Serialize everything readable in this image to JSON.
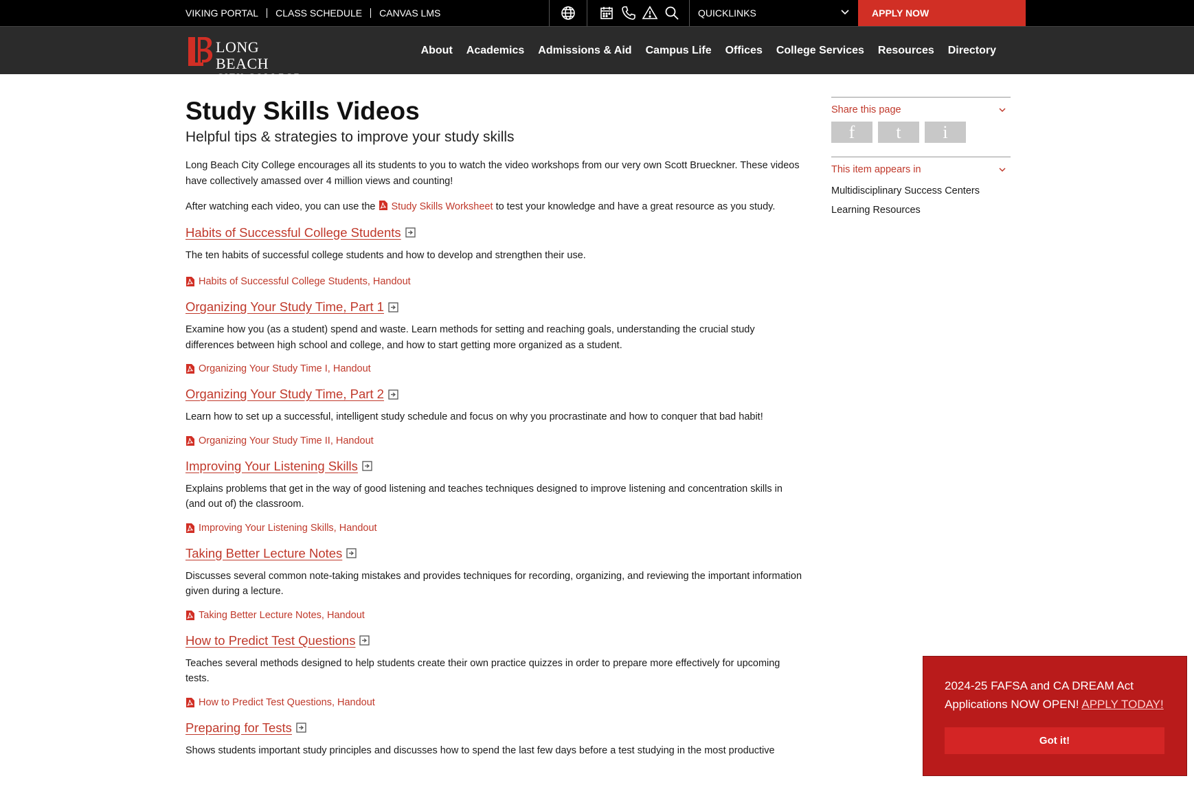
{
  "topbar": {
    "links": [
      "VIKING PORTAL",
      "CLASS SCHEDULE",
      "CANVAS LMS"
    ],
    "quicklinks_label": "QUICKLINKS",
    "apply_label": "APPLY NOW"
  },
  "logo": {
    "line1": "LONG BEACH",
    "line2": "CITY COLLEGE"
  },
  "nav": [
    "About",
    "Academics",
    "Admissions & Aid",
    "Campus Life",
    "Offices",
    "College Services",
    "Resources",
    "Directory"
  ],
  "page": {
    "title": "Study Skills Videos",
    "subtitle": "Helpful tips & strategies to improve your study skills",
    "intro": "Long Beach City College encourages all its students to you to watch the video workshops from our very own Scott Brueckner. These videos have collectively amassed over 4 million views and counting!",
    "worksheet_prefix": "After watching each video, you can use the",
    "worksheet_link": "Study Skills Worksheet",
    "worksheet_suffix": "to test your knowledge and have a great resource as you study."
  },
  "videos": [
    {
      "title": "Habits of Successful College Students",
      "desc": "The ten habits of successful college students and how to develop and strengthen their use.",
      "handout": "Habits of Successful College Students, Handout"
    },
    {
      "title": "Organizing Your Study Time, Part 1",
      "desc": "Examine how you (as a student) spend and waste. Learn methods for setting and reaching goals, understanding the crucial study differences between high school and college, and how to start getting more organized as a student.",
      "handout": "Organizing Your Study Time I, Handout"
    },
    {
      "title": "Organizing Your Study Time, Part 2",
      "desc": "Learn how to set up a successful, intelligent study schedule and focus on why you procrastinate and how to conquer that bad habit!",
      "handout": "Organizing Your Study Time II, Handout"
    },
    {
      "title": "Improving Your Listening Skills",
      "desc": "Explains problems that get in the way of good listening and teaches techniques designed to improve listening and concentration skills in (and out of) the classroom.",
      "handout": "Improving Your Listening Skills, Handout"
    },
    {
      "title": "Taking Better Lecture Notes",
      "desc": "Discusses several common note-taking mistakes and provides techniques for recording, organizing, and reviewing the important information given during a lecture.",
      "handout": "Taking Better Lecture Notes, Handout"
    },
    {
      "title": "How to Predict Test Questions",
      "desc": "Teaches several methods designed to help students create their own practice quizzes in order to prepare more effectively for upcoming tests.",
      "handout": "How to Predict Test Questions, Handout"
    },
    {
      "title": "Preparing for Tests",
      "desc": "Shows students important study principles and discusses how to spend the last few days before a test studying in the most productive",
      "handout": ""
    }
  ],
  "sidebar": {
    "share_label": "Share this page",
    "share_buttons": [
      "f",
      "t",
      "i"
    ],
    "appears_label": "This item appears in",
    "appears_items": [
      "Multidisciplinary Success Centers",
      "Learning Resources"
    ]
  },
  "banner": {
    "text": "2024-25 FAFSA and CA DREAM Act Applications NOW OPEN!",
    "link": "APPLY TODAY!",
    "button": "Got it!"
  },
  "colors": {
    "accent": "#c0392b",
    "apply": "#d12f25",
    "banner": "#b91b1b",
    "nav_bg": "#2b2b2b"
  }
}
